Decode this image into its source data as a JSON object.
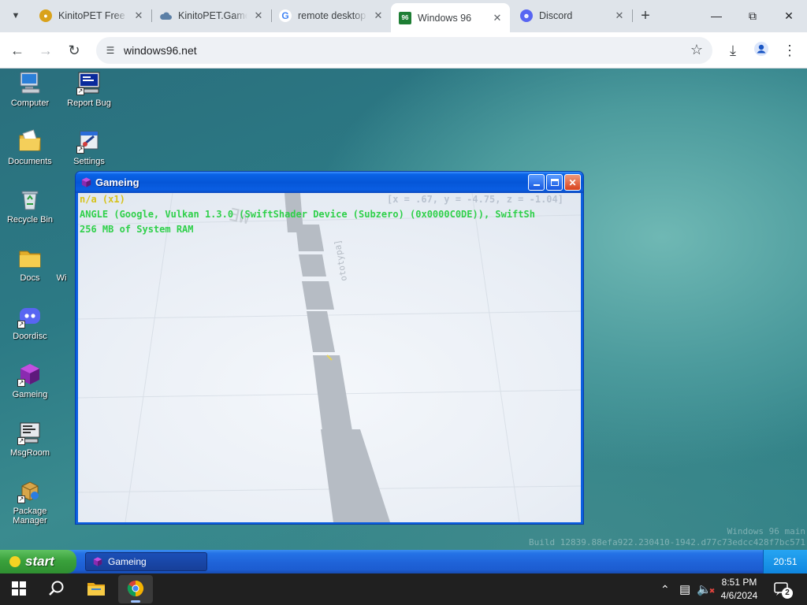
{
  "browser": {
    "tabs": [
      {
        "title": "KinitoPET Free",
        "favicon": "skull-icon",
        "active": false
      },
      {
        "title": "KinitoPET.Game",
        "favicon": "cloud-icon",
        "active": false
      },
      {
        "title": "remote desktop",
        "favicon": "google-icon",
        "active": false
      },
      {
        "title": "Windows 96",
        "favicon": "windows96-icon",
        "active": true
      },
      {
        "title": "Discord",
        "favicon": "discord-icon",
        "active": false
      }
    ],
    "url": "windows96.net"
  },
  "desktop": {
    "icons": [
      {
        "label": "Computer",
        "icon": "computer-icon"
      },
      {
        "label": "Report Bug",
        "icon": "report-bug-icon"
      },
      {
        "label": "Documents",
        "icon": "documents-folder-icon"
      },
      {
        "label": "Settings",
        "icon": "settings-icon"
      },
      {
        "label": "Recycle Bin",
        "icon": "recycle-bin-icon"
      },
      {
        "label": "Docs",
        "icon": "folder-icon"
      },
      {
        "label": "Wi",
        "icon": ""
      },
      {
        "label": "Doordisc",
        "icon": "doordisc-icon"
      },
      {
        "label": "Gameing",
        "icon": "gameing-cube-icon"
      },
      {
        "label": "MsgRoom",
        "icon": "msgroom-icon"
      },
      {
        "label": "Package Manager",
        "icon": "package-manager-icon"
      }
    ],
    "build_info": {
      "line1": "Windows 96 main",
      "line2": "Build 12839.88efa922.230410-1942.d77c73edcc428f7bc571"
    }
  },
  "window": {
    "title": "Gameing",
    "hud": {
      "line1": "n/a (x1)",
      "coords": "[x = .67, y = -4.75, z = -1.04]",
      "line2": "ANGLE (Google, Vulkan 1.3.0 (SwiftShader Device (Subzero) (0x0000C0DE)), SwiftSh",
      "line3": "256 MB of System RAM"
    }
  },
  "win96_taskbar": {
    "start_label": "start",
    "task_label": "Gameing",
    "clock": "20:51"
  },
  "windows_taskbar": {
    "time": "8:51 PM",
    "date": "4/6/2024",
    "notification_count": "2"
  },
  "colors": {
    "win96_blue": "#0b5fe0",
    "start_green": "#3aa13c",
    "hud_yellow": "#d6c21a",
    "hud_green": "#2fd04a"
  }
}
